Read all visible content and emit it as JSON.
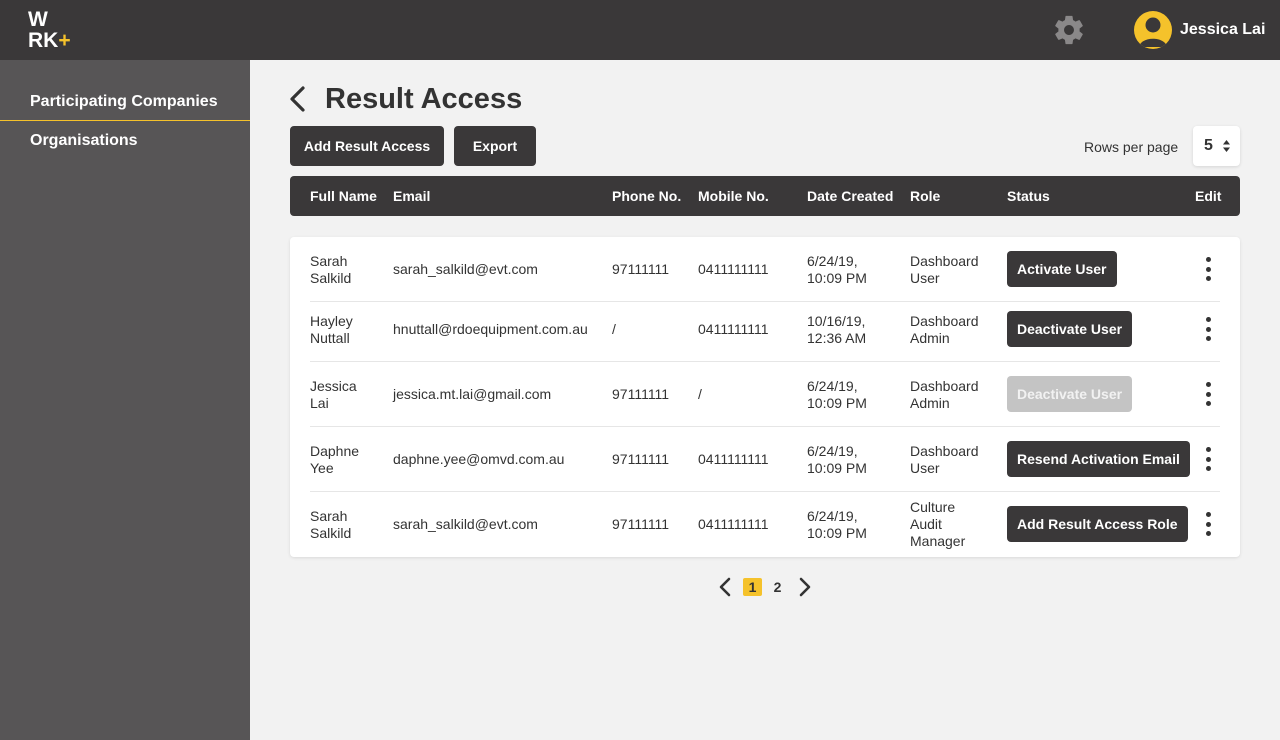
{
  "header": {
    "logo_line1": "W",
    "logo_line2": "RK",
    "logo_plus": "+",
    "settings_icon": "gear-icon",
    "user_name": "Jessica Lai",
    "avatar_icon": "user-avatar-icon"
  },
  "sidebar": {
    "items": [
      {
        "label": "Participating Companies",
        "active": true
      },
      {
        "label": "Organisations",
        "active": false
      }
    ]
  },
  "page": {
    "title": "Result Access",
    "back_icon": "chevron-left-icon"
  },
  "toolbar": {
    "add_label": "Add Result Access",
    "export_label": "Export",
    "rows_per_page_label": "Rows per page",
    "rows_per_page_value": "5"
  },
  "table": {
    "columns": [
      "Full Name",
      "Email",
      "Phone No.",
      "Mobile No.",
      "Date Created",
      "Role",
      "Status",
      "Edit"
    ],
    "rows": [
      {
        "name": [
          "Sarah",
          "Salkild"
        ],
        "email": "sarah_salkild@evt.com",
        "phone": "97111111",
        "mobile": "0411111111",
        "date": [
          "6/24/19,",
          "10:09 PM"
        ],
        "role": [
          "Dashboard",
          "User"
        ],
        "status": "Activate User",
        "status_disabled": false
      },
      {
        "name": [
          "Hayley",
          "Nuttall"
        ],
        "email": "hnuttall@rdoequipment.com.au",
        "phone": "/",
        "mobile": "0411111111",
        "date": [
          "10/16/19,",
          "12:36 AM"
        ],
        "role": [
          "Dashboard",
          "Admin"
        ],
        "status": "Deactivate User",
        "status_disabled": false
      },
      {
        "name": [
          "Jessica",
          "Lai"
        ],
        "email": "jessica.mt.lai@gmail.com",
        "phone": "97111111",
        "mobile": "/",
        "date": [
          "6/24/19,",
          "10:09 PM"
        ],
        "role": [
          "Dashboard",
          "Admin"
        ],
        "status": "Deactivate User",
        "status_disabled": true
      },
      {
        "name": [
          "Daphne",
          "Yee"
        ],
        "email": "daphne.yee@omvd.com.au",
        "phone": "97111111",
        "mobile": "0411111111",
        "date": [
          "6/24/19,",
          "10:09 PM"
        ],
        "role": [
          "Dashboard",
          "User"
        ],
        "status": "Resend Activation Email",
        "status_disabled": false
      },
      {
        "name": [
          "Sarah",
          "Salkild"
        ],
        "email": "sarah_salkild@evt.com",
        "phone": "97111111",
        "mobile": "0411111111",
        "date": [
          "6/24/19,",
          "10:09 PM"
        ],
        "role": [
          "Culture",
          "Audit",
          "Manager"
        ],
        "status": "Add Result Access Role",
        "status_disabled": false
      }
    ]
  },
  "pagination": {
    "pages": [
      "1",
      "2"
    ],
    "current": "1"
  },
  "colors": {
    "dark": "#3a3839",
    "sidebar": "#575556",
    "accent": "#f5c22b",
    "disabled": "#c4c4c4"
  }
}
